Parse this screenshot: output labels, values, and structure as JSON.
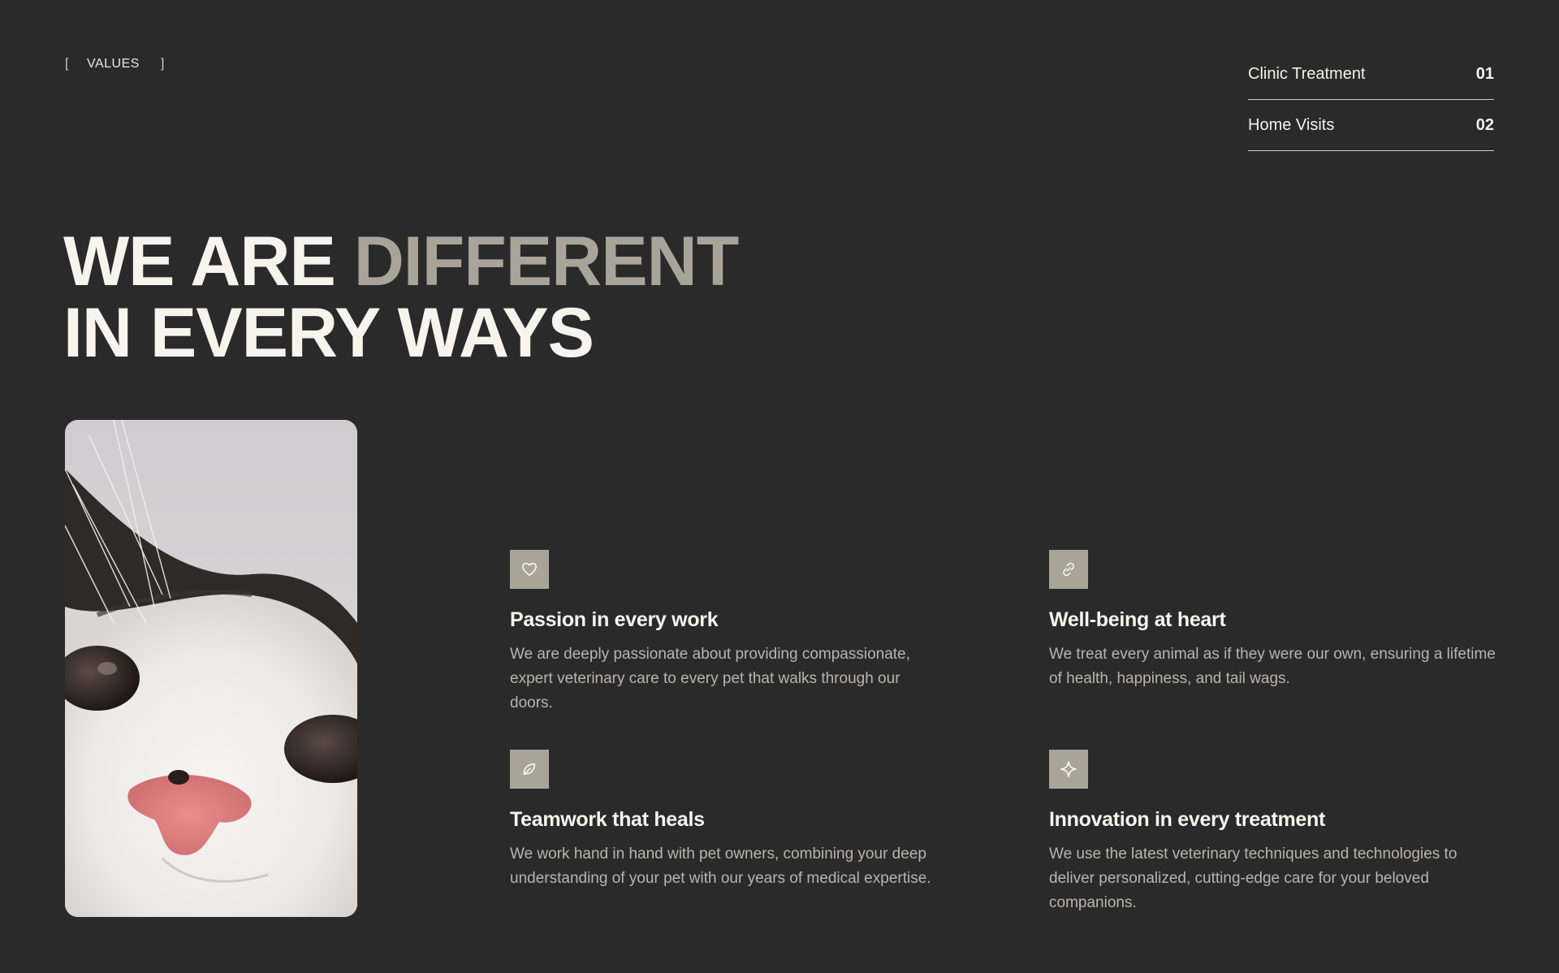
{
  "section_tag": {
    "bracket_open": "[",
    "label": "VALUES",
    "bracket_close": "]"
  },
  "services": [
    {
      "label": "Clinic Treatment",
      "number": "01"
    },
    {
      "label": "Home Visits",
      "number": "02"
    }
  ],
  "headline": {
    "line1_main": "WE ARE ",
    "line1_accent": "DIFFERENT",
    "line2": "IN EVERY WAYS"
  },
  "features": [
    {
      "icon": "heart-icon",
      "title": "Passion in every work",
      "description": "We are deeply passionate about providing compassionate, expert veterinary care to every pet that walks through our doors."
    },
    {
      "icon": "link-icon",
      "title": "Well-being at heart",
      "description": "We treat every animal as if they were our own, ensuring a lifetime of health, happiness, and tail wags."
    },
    {
      "icon": "leaf-icon",
      "title": "Teamwork that heals",
      "description": "We work hand in hand with pet owners, combining your deep understanding of your pet with our years of medical expertise."
    },
    {
      "icon": "sparkle-icon",
      "title": "Innovation in every treatment",
      "description": "We use the latest veterinary techniques and technologies to deliver personalized, cutting-edge care for your beloved companions."
    }
  ],
  "colors": {
    "background": "#2a2a2a",
    "accent_text": "#a8a499",
    "icon_box": "#a8a598"
  }
}
